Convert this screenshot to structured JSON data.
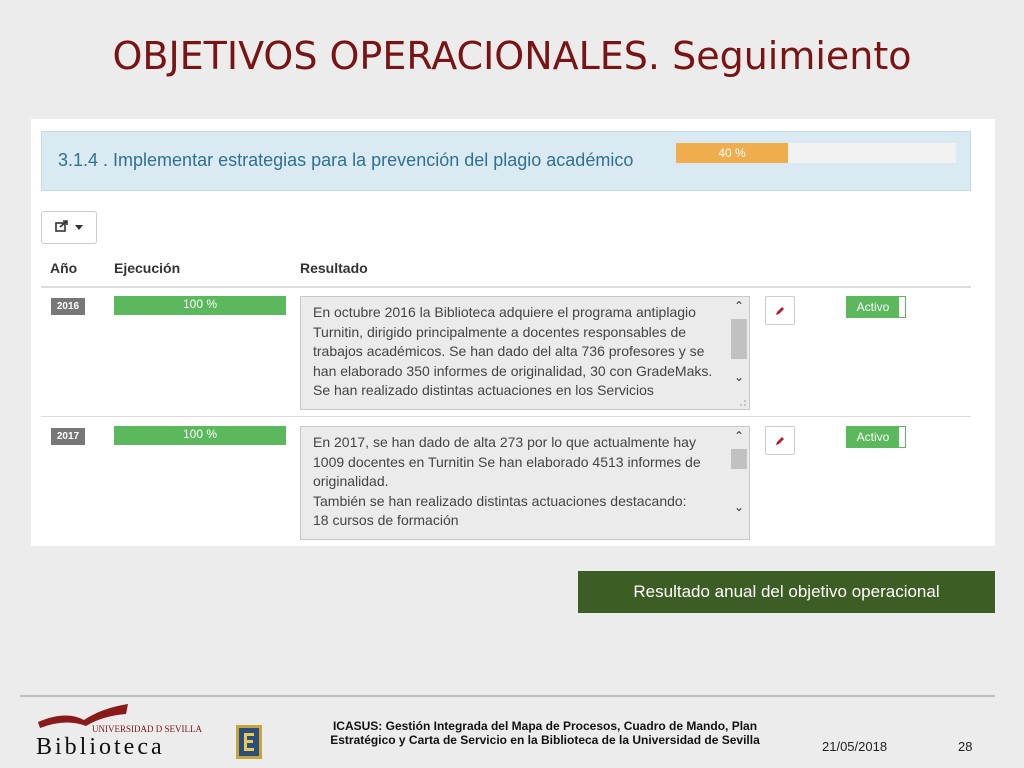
{
  "slide": {
    "title": "OBJETIVOS OPERACIONALES. Seguimiento"
  },
  "objective": {
    "title": "3.1.4 . Implementar estrategias para la prevención del plagio académico",
    "progress_label": "40 %",
    "progress_value": 0.4,
    "progress_color": "#f0ad4e"
  },
  "toolbar": {
    "export_icon": "share-export-icon"
  },
  "table": {
    "headers": [
      "Año",
      "Ejecución",
      "Resultado"
    ],
    "rows": [
      {
        "year": "2016",
        "execution_label": "100 %",
        "execution_value": 1.0,
        "result": "En octubre 2016 la Biblioteca adquiere el programa antiplagio Turnitin, dirigido principalmente a docentes responsables de trabajos académicos. Se han dado del alta 736 profesores y se han elaborado 350 informes de originalidad, 30 con GradeMaks. Se han realizado distintas actuaciones en los Servicios",
        "status": "Activo"
      },
      {
        "year": "2017",
        "execution_label": "100 %",
        "execution_value": 1.0,
        "result": "En 2017, se han dado de alta 273 por lo que actualmente hay 1009 docentes en Turnitin Se han elaborado 4513 informes de originalidad.\nTambién se han realizado distintas actuaciones destacando:\n18 cursos de formación",
        "status": "Activo"
      }
    ]
  },
  "caption": "Resultado anual del objetivo operacional",
  "footer": {
    "logo_university": "UNIVERSIDAD D SEVILLA",
    "logo_library": "Biblioteca",
    "text_line1": "ICASUS: Gestión Integrada del Mapa de Procesos, Cuadro de Mando, Plan",
    "text_line2": "Estratégico y Carta de Servicio en la Biblioteca de la Universidad de Sevilla",
    "date": "21/05/2018",
    "page": "28"
  },
  "colors": {
    "title": "#7a1414",
    "success": "#5cb85c",
    "warning": "#f0ad4e",
    "header_bg": "#d9eaf3",
    "caption_bg": "#3c5e24"
  }
}
